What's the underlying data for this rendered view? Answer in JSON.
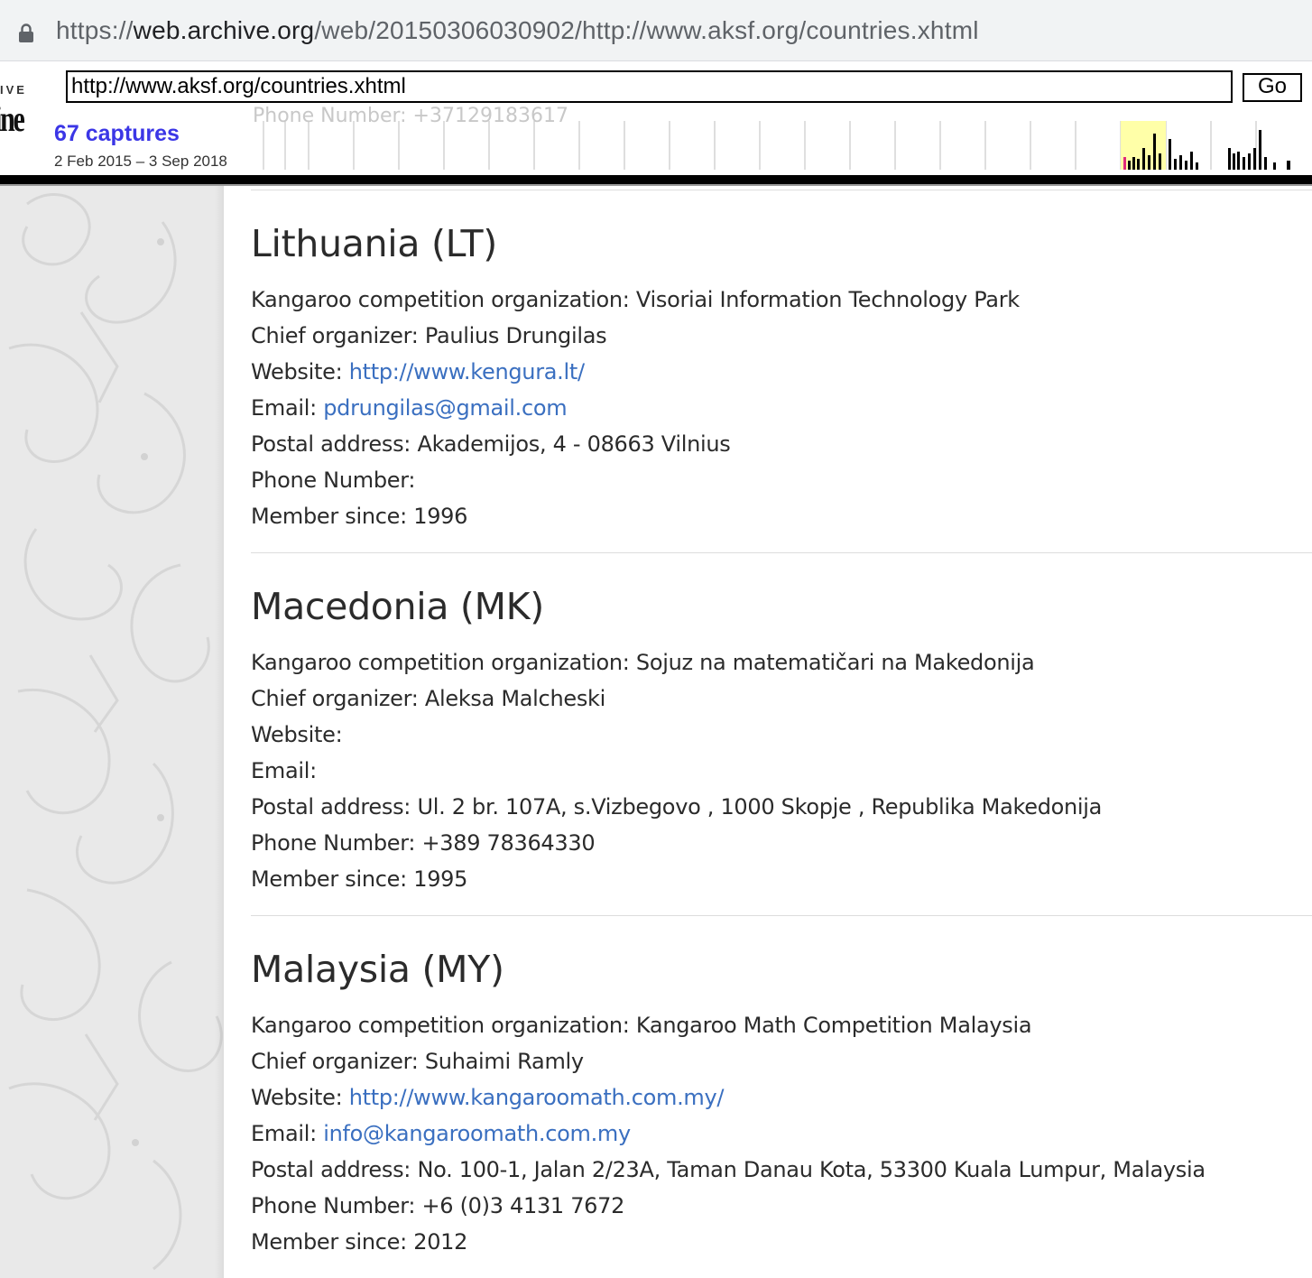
{
  "browser": {
    "url_scheme": "https://",
    "url_host": "web.archive.org",
    "url_path": "/web/20150306030902/http://www.aksf.org/countries.xhtml"
  },
  "wayback": {
    "logo_top": "IVE",
    "logo_bottom": "ine",
    "url_value": "http://www.aksf.org/countries.xhtml",
    "go_label": "Go",
    "captures_label": "67 captures",
    "date_range": "2 Feb 2015 – 3 Sep 2018",
    "ghost_text": "Phone Number: +37129183617",
    "highlight_color": "#ffffa8",
    "bar_color": "#000000",
    "selected_bar_color": "#e0297b"
  },
  "countries": [
    {
      "name": "Lithuania (LT)",
      "org_label": "Kangaroo competition organization:",
      "org": "Visoriai Information Technology Park",
      "chief_label": "Chief organizer:",
      "chief": "Paulius Drungilas",
      "website_label": "Website:",
      "website": "http://www.kengura.lt/",
      "email_label": "Email:",
      "email": "pdrungilas@gmail.com",
      "postal_label": "Postal address:",
      "postal": "Akademijos, 4 - 08663 Vilnius",
      "phone_label": "Phone Number:",
      "phone": "",
      "member_label": "Member since:",
      "member": "1996"
    },
    {
      "name": "Macedonia (MK)",
      "org_label": "Kangaroo competition organization:",
      "org": "Sojuz na matematičari na Makedonija",
      "chief_label": "Chief organizer:",
      "chief": "Aleksa Malcheski",
      "website_label": "Website:",
      "website": "",
      "email_label": "Email:",
      "email": "",
      "postal_label": "Postal address:",
      "postal": "Ul. 2 br. 107A, s.Vizbegovo , 1000 Skopje , Republika Makedonija",
      "phone_label": "Phone Number:",
      "phone": "+389 78364330",
      "member_label": "Member since:",
      "member": "1995"
    },
    {
      "name": "Malaysia (MY)",
      "org_label": "Kangaroo competition organization:",
      "org": "Kangaroo Math Competition Malaysia",
      "chief_label": "Chief organizer:",
      "chief": "Suhaimi Ramly",
      "website_label": "Website:",
      "website": "http://www.kangaroomath.com.my/",
      "email_label": "Email:",
      "email": "info@kangaroomath.com.my",
      "postal_label": "Postal address:",
      "postal": "No. 100-1, Jalan 2/23A, Taman Danau Kota, 53300 Kuala Lumpur, Malaysia",
      "phone_label": "Phone Number:",
      "phone": "+6 (0)3 4131 7672",
      "member_label": "Member since:",
      "member": "2012"
    }
  ]
}
